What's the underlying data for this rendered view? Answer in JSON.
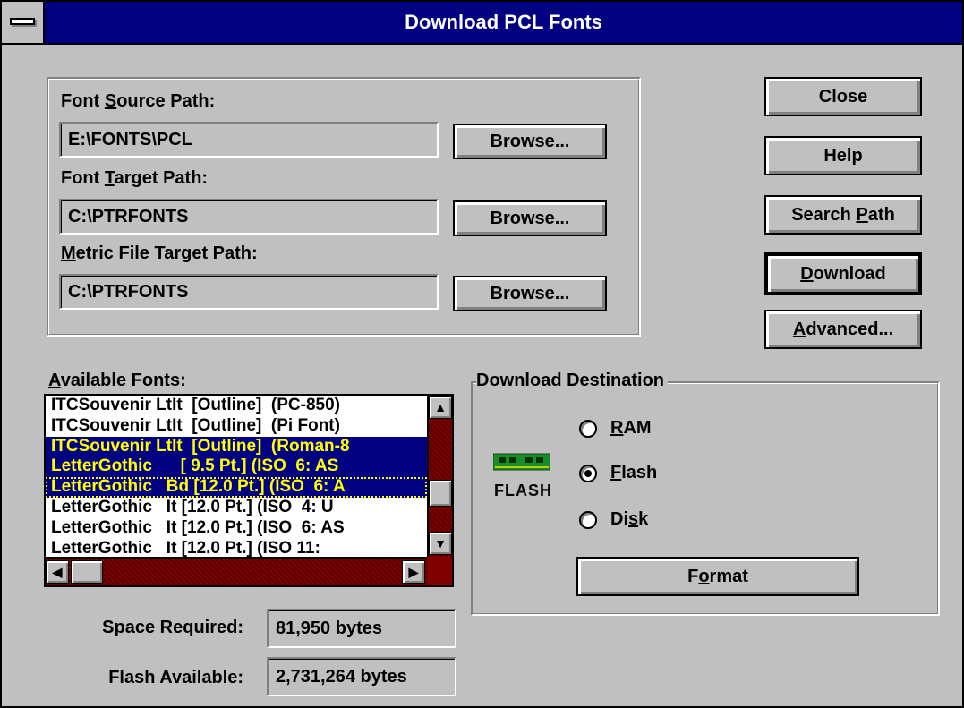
{
  "window": {
    "title": "Download PCL Fonts"
  },
  "paths": {
    "source_label_pre": "Font ",
    "source_label_key": "S",
    "source_label_post": "ource Path:",
    "source_value": "E:\\FONTS\\PCL",
    "target_label_pre": "Font ",
    "target_label_key": "T",
    "target_label_post": "arget Path:",
    "target_value": "C:\\PTRFONTS",
    "metric_label_key": "M",
    "metric_label_post": "etric File Target Path:",
    "metric_value": "C:\\PTRFONTS",
    "browse_label": "Browse..."
  },
  "buttons": {
    "close": "Close",
    "help": "Help",
    "search_pre": "Search ",
    "search_key": "P",
    "search_post": "ath",
    "download_key": "D",
    "download_post": "ownload",
    "advanced_key": "A",
    "advanced_post": "dvanced..."
  },
  "fonts": {
    "label_key": "A",
    "label_post": "vailable Fonts:",
    "items": [
      "ITCSouvenir LtIt  [Outline]  (PC-850)",
      "ITCSouvenir LtIt  [Outline]  (Pi Font)",
      "ITCSouvenir LtIt  [Outline]  (Roman-8",
      "LetterGothic      [ 9.5 Pt.] (ISO  6: AS",
      "LetterGothic   Bd [12.0 Pt.] (ISO  6: A",
      "LetterGothic   It [12.0 Pt.] (ISO  4: U",
      "LetterGothic   It [12.0 Pt.] (ISO  6: AS",
      "LetterGothic   It [12.0 Pt.] (ISO 11:"
    ],
    "selected": [
      2,
      3,
      4
    ],
    "focused": 4
  },
  "destination": {
    "title": "Download Destination",
    "icon_label": "FLASH",
    "options": [
      {
        "key": "R",
        "rest": "AM",
        "checked": false
      },
      {
        "key": "F",
        "rest": "lash",
        "checked": true
      },
      {
        "pre": "Di",
        "key": "s",
        "rest": "k",
        "checked": false
      }
    ],
    "format_pre": "F",
    "format_key": "o",
    "format_post": "rmat"
  },
  "stats": {
    "space_label": "Space Required:",
    "space_value": "81,950 bytes",
    "flash_label": "Flash Available:",
    "flash_value": "2,731,264 bytes"
  },
  "colors": {
    "title_bar": "#000080",
    "face": "#c0c0c0",
    "selection": "#000080",
    "selection_text": "#ffff00",
    "scroll_track": "#800000",
    "chip": "#1a8c2c"
  }
}
